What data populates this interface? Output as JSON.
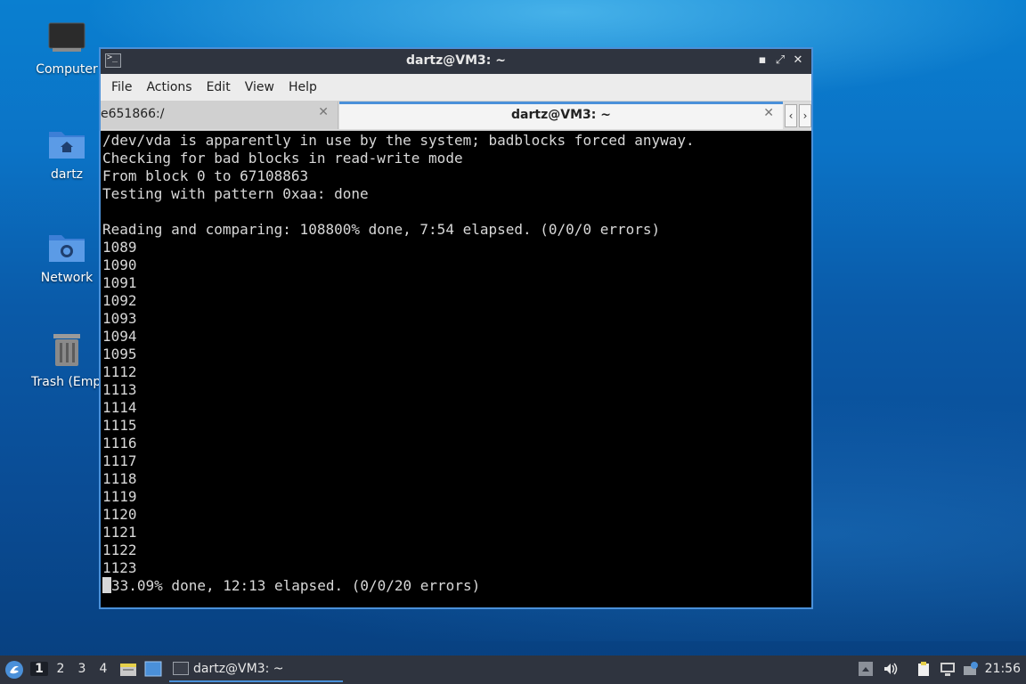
{
  "desktop": {
    "icons": [
      {
        "label": "Computer"
      },
      {
        "label": "dartz"
      },
      {
        "label": "Network"
      },
      {
        "label": "Trash (Empt"
      }
    ]
  },
  "window": {
    "title": "dartz@VM3: ~",
    "menu": [
      "File",
      "Actions",
      "Edit",
      "View",
      "Help"
    ],
    "tabs": [
      {
        "label": "e651866:/",
        "active": false
      },
      {
        "label": "dartz@VM3: ~",
        "active": true
      }
    ],
    "terminal": {
      "lines": [
        "/dev/vda is apparently in use by the system; badblocks forced anyway.",
        "Checking for bad blocks in read-write mode",
        "From block 0 to 67108863",
        "Testing with pattern 0xaa: done",
        "",
        "Reading and comparing: 108800% done, 7:54 elapsed. (0/0/0 errors)",
        "1089",
        "1090",
        "1091",
        "1092",
        "1093",
        "1094",
        "1095",
        "1112",
        "1113",
        "1114",
        "1115",
        "1116",
        "1117",
        "1118",
        "1119",
        "1120",
        "1121",
        "1122",
        "1123"
      ],
      "last_line": "33.09% done, 12:13 elapsed. (0/0/20 errors)"
    }
  },
  "taskbar": {
    "workspaces": [
      "1",
      "2",
      "3",
      "4"
    ],
    "active_workspace": "1",
    "task_label": "dartz@VM3: ~",
    "clock": "21:56"
  },
  "colors": {
    "accent": "#4a90d9",
    "titlebar": "#2f343f",
    "terminal_bg": "#000000",
    "terminal_fg": "#d8d8d8"
  }
}
